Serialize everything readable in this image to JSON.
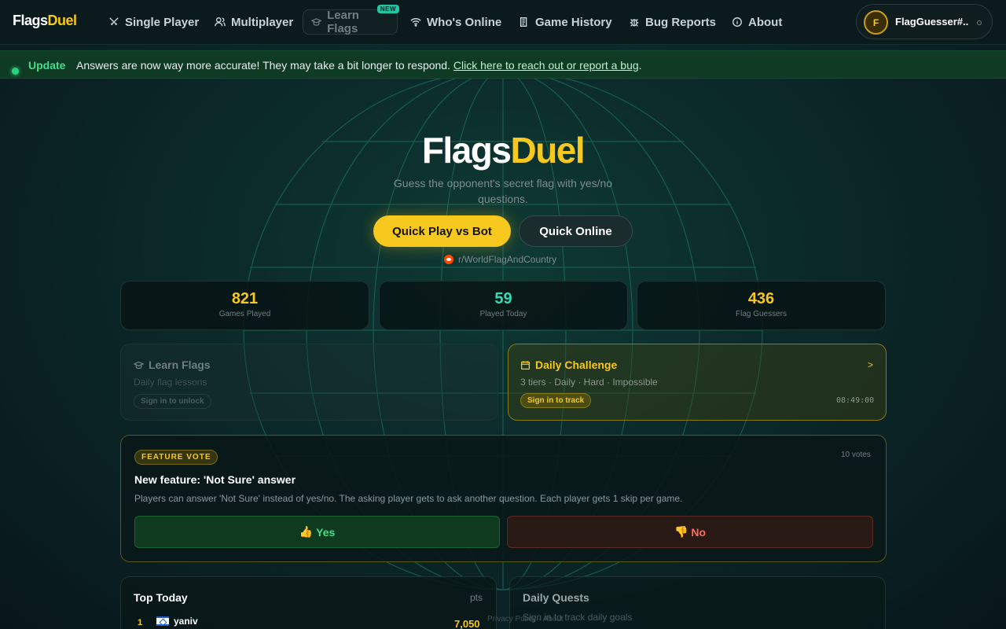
{
  "brand": {
    "part1": "Flags",
    "part2": "Duel"
  },
  "nav": {
    "single_player": "Single Player",
    "multiplayer": "Multiplayer",
    "learn_flags": "Learn Flags",
    "learn_flags_badge": "NEW",
    "whos_online": "Who's Online",
    "game_history": "Game History",
    "bug_reports": "Bug Reports",
    "about": "About"
  },
  "user": {
    "initial": "F",
    "name": "FlagGuesser#..."
  },
  "banner": {
    "tag": "Update",
    "message": "Answers are now way more accurate! They may take a bit longer to respond. ",
    "link": "Click here to reach out or report a bug",
    "suffix": "."
  },
  "hero": {
    "title_part1": "Flags",
    "title_part2": "Duel",
    "subtitle": "Guess the opponent's secret flag with yes/no questions.",
    "primary_button": "Quick Play vs Bot",
    "secondary_button": "Quick Online",
    "reddit": "r/WorldFlagAndCountry"
  },
  "stats": [
    {
      "value": "821",
      "label": "Games Played"
    },
    {
      "value": "59",
      "label": "Played Today"
    },
    {
      "value": "436",
      "label": "Flag Guessers"
    }
  ],
  "learn_card": {
    "title": "Learn Flags",
    "desc": "Daily flag lessons",
    "pill": "Sign in to unlock"
  },
  "daily_card": {
    "title": "Daily Challenge",
    "desc": "3 tiers · Daily · Hard · Impossible",
    "pill": "Sign in to track",
    "timer": "08:49:00",
    "chevron": ">"
  },
  "vote": {
    "tag": "FEATURE VOTE",
    "count": "10 votes",
    "title": "New feature: 'Not Sure' answer",
    "desc": "Players can answer 'Not Sure' instead of yes/no. The asking player gets to ask another question. Each player gets 1 skip per game.",
    "yes": "Yes",
    "no": "No"
  },
  "top_today": {
    "title": "Top Today",
    "pts_label": "pts",
    "rows": [
      {
        "rank": "1",
        "name": "yaniv",
        "score": "7,050"
      }
    ]
  },
  "quests": {
    "title": "Daily Quests",
    "desc": "Sign in to track daily goals"
  },
  "footer": {
    "text": "Privacy Policy · About"
  },
  "colors": {
    "accent": "#f7c81e",
    "teal": "#35d9b5",
    "green": "#3ee08a",
    "red": "#ff6b5a"
  }
}
